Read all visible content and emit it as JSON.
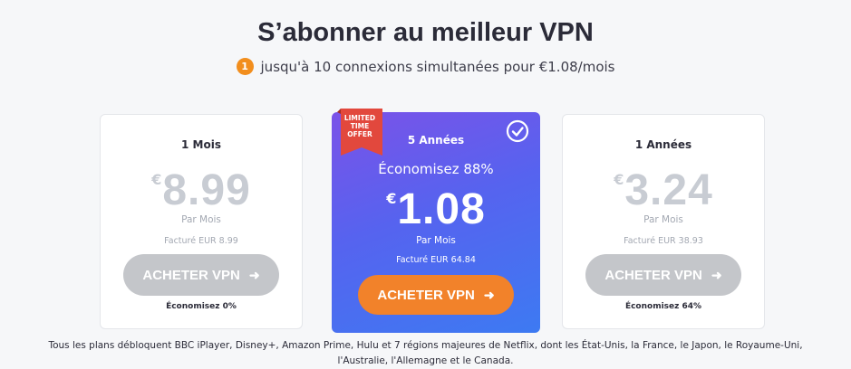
{
  "header": {
    "title": "S’abonner au meilleur VPN",
    "badge_number": "1",
    "subtitle": "jusqu'à 10 connexions simultanées pour €1.08/mois"
  },
  "plans": [
    {
      "name": "1 Mois",
      "currency": "€",
      "price": "8.99",
      "per": "Par Mois",
      "billed": "Facturé EUR 8.99",
      "button": "ACHETER VPN",
      "savings": "Économisez 0%"
    },
    {
      "name": "5 Années",
      "ribbon": "LIMITED TIME OFFER",
      "savings_headline": "Économisez 88%",
      "currency": "€",
      "price": "1.08",
      "per": "Par Mois",
      "billed": "Facturé EUR 64.84",
      "button": "ACHETER VPN"
    },
    {
      "name": "1 Années",
      "currency": "€",
      "price": "3.24",
      "per": "Par Mois",
      "billed": "Facturé EUR 38.93",
      "button": "ACHETER VPN",
      "savings": "Économisez 64%"
    }
  ],
  "footer": {
    "line1": "Tous les plans débloquent BBC iPlayer, Disney+, Amazon Prime, Hulu et 7 régions majeures de Netflix, dont les État-Unis, la France, le Japon, le Royaume-Uni,",
    "line2": "l'Australie, l'Allemagne et le Canada."
  },
  "icons": {
    "button_arrow": "arrow-right-icon",
    "selected": "check-circle-icon",
    "ribbon": "ribbon-icon"
  },
  "colors": {
    "accent_orange": "#f2822a",
    "featured_gradient_start": "#7b52e8",
    "featured_gradient_end": "#3d7af2",
    "disabled_button": "#c4c6ca",
    "ribbon_red": "#e2483d"
  }
}
